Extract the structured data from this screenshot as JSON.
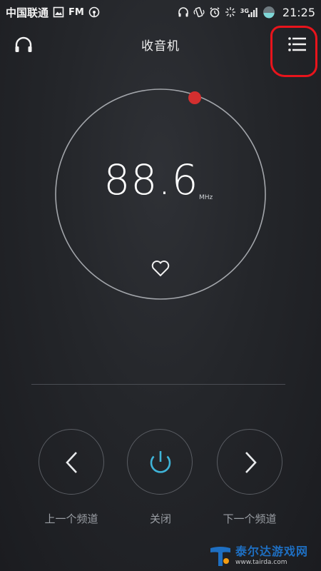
{
  "status_bar": {
    "carrier": "中国联通",
    "fm_label": "FM",
    "network_label": "3G",
    "time": "21:25",
    "icons": [
      "image-icon",
      "fm-radio-icon",
      "headphone-status-icon",
      "vibrate-icon",
      "alarm-icon",
      "data-transfer-icon",
      "signal-icon",
      "battery-icon"
    ]
  },
  "header": {
    "title": "收音机",
    "left_icon": "headphone-icon",
    "right_icon": "menu-list-icon"
  },
  "dial": {
    "frequency": "88.6",
    "unit": "MHz",
    "favorite_icon": "heart-icon",
    "tuner_knob_color": "#d32f2f"
  },
  "controls": {
    "prev_label": "上一个频道",
    "power_label": "关闭",
    "next_label": "下一个频道",
    "power_color": "#3fb4d8"
  },
  "watermark": {
    "brand": "泰尔达游戏网",
    "url": "www.tairda.com"
  }
}
